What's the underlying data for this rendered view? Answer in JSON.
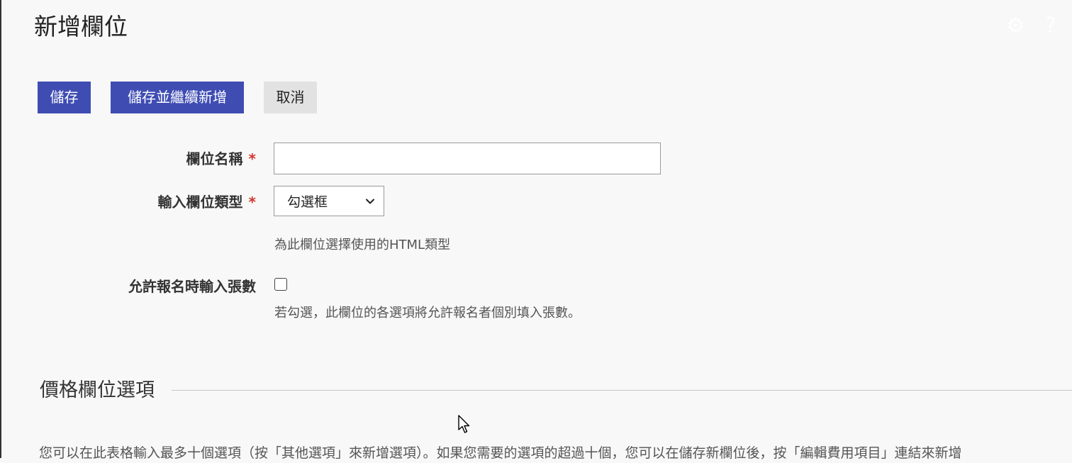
{
  "header": {
    "title": "新增欄位",
    "icons": [
      "gear-icon",
      "help-icon"
    ]
  },
  "toolbar": {
    "save_label": "儲存",
    "save_continue_label": "儲存並繼續新增",
    "cancel_label": "取消"
  },
  "form": {
    "field_name": {
      "label": "欄位名稱",
      "required_mark": "*",
      "value": "",
      "placeholder": ""
    },
    "input_type": {
      "label": "輸入欄位類型",
      "required_mark": "*",
      "selected": "勾選框",
      "help": "為此欄位選擇使用的HTML類型"
    },
    "allow_quantity": {
      "label": "允許報名時輸入張數",
      "checked": false,
      "help": "若勾選，此欄位的各選項將允許報名者個別填入張數。"
    }
  },
  "price_section": {
    "title": "價格欄位選項",
    "intro": "您可以在此表格輸入最多十個選項（按「其他選項」來新增選項）。如果您需要的選項的超過十個，您可以在儲存新欄位後，按「編輯費用項目」連結來新增"
  },
  "colors": {
    "primary_button": "#3f4db3",
    "cancel_button": "#e2e2e2",
    "required": "#d0342c",
    "background": "#f8f8f8"
  }
}
